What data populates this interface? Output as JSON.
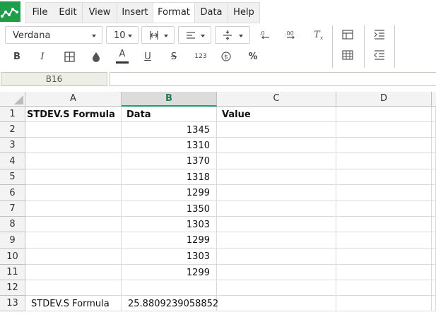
{
  "menubar": {
    "items": [
      {
        "label": "File"
      },
      {
        "label": "Edit"
      },
      {
        "label": "View"
      },
      {
        "label": "Insert"
      },
      {
        "label": "Format"
      },
      {
        "label": "Data"
      },
      {
        "label": "Help"
      }
    ],
    "active": "Format"
  },
  "toolbar": {
    "font_family": "Verdana",
    "font_size": "10",
    "number_format_label": "123",
    "icons": [
      "merge-cells-icon",
      "horizontal-align-icon",
      "vertical-align-icon",
      "decrease-decimals-icon",
      "increase-decimals-icon",
      "clear-format-icon",
      "borders-table-icon",
      "grid-icon",
      "indent-increase-icon",
      "indent-decrease-icon",
      "bold-icon",
      "italic-icon",
      "borders-icon",
      "fill-color-icon",
      "text-color-icon",
      "underline-icon",
      "strikethrough-icon",
      "number-format-icon",
      "currency-icon",
      "percent-icon"
    ],
    "bold_label": "B",
    "italic_label": "I",
    "text_color_label": "A",
    "underline_label": "U",
    "strike_label": "S",
    "percent_label": "%",
    "text_color": "#222222",
    "accent": "#1ba260"
  },
  "formula_bar": {
    "cell_ref": "B16",
    "value": ""
  },
  "sheet": {
    "columns": [
      "A",
      "B",
      "C",
      "D"
    ],
    "selected_column": "B",
    "rows": [
      {
        "num": "1",
        "a": "STDEV.S Formula",
        "b": "Data",
        "c": "Value",
        "d": ""
      },
      {
        "num": "2",
        "a": "",
        "b": "1345",
        "c": "",
        "d": ""
      },
      {
        "num": "3",
        "a": "",
        "b": "1310",
        "c": "",
        "d": ""
      },
      {
        "num": "4",
        "a": "",
        "b": "1370",
        "c": "",
        "d": ""
      },
      {
        "num": "5",
        "a": "",
        "b": "1318",
        "c": "",
        "d": ""
      },
      {
        "num": "6",
        "a": "",
        "b": "1299",
        "c": "",
        "d": ""
      },
      {
        "num": "7",
        "a": "",
        "b": "1350",
        "c": "",
        "d": ""
      },
      {
        "num": "8",
        "a": "",
        "b": "1303",
        "c": "",
        "d": ""
      },
      {
        "num": "9",
        "a": "",
        "b": "1299",
        "c": "",
        "d": ""
      },
      {
        "num": "10",
        "a": "",
        "b": "1303",
        "c": "",
        "d": ""
      },
      {
        "num": "11",
        "a": "",
        "b": "1299",
        "c": "",
        "d": ""
      },
      {
        "num": "12",
        "a": "",
        "b": "",
        "c": "",
        "d": ""
      },
      {
        "num": "13",
        "a": "STDEV.S Formula",
        "b": "25.8809239058852",
        "c": "",
        "d": ""
      }
    ]
  }
}
